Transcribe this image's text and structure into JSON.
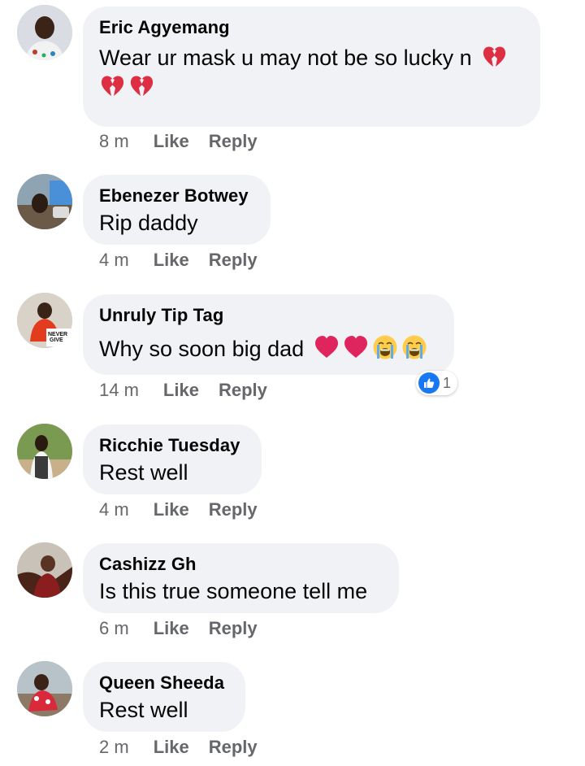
{
  "colors": {
    "bubble": "#f0f2f5",
    "meta_text": "#65676b",
    "like_blue": "#1877f2",
    "heart_red": "#e0245e",
    "broken_heart": "#dd2e44"
  },
  "actions": {
    "like": "Like",
    "reply": "Reply"
  },
  "comments": [
    {
      "author": "Eric Agyemang",
      "text": "Wear ur mask u may not be so lucky n",
      "emojis_line1": [
        "broken-heart"
      ],
      "emojis_line2": [
        "broken-heart",
        "broken-heart"
      ],
      "time": "8 m"
    },
    {
      "author": "Ebenezer Botwey",
      "text": "Rip daddy",
      "time": "4 m"
    },
    {
      "author": "Unruly Tip Tag",
      "text": "Why so soon big dad",
      "emojis": [
        "red-heart",
        "red-heart",
        "loudly-crying-face",
        "loudly-crying-face"
      ],
      "time": "14 m",
      "reaction": {
        "icon": "thumbs-up",
        "count": "1"
      }
    },
    {
      "author": "Ricchie Tuesday",
      "text": "Rest well",
      "time": "4 m"
    },
    {
      "author": "Cashizz Gh",
      "text": "Is this true someone tell me",
      "time": "6 m"
    },
    {
      "author": "Queen Sheeda",
      "text": "Rest well",
      "time": "2 m"
    }
  ]
}
